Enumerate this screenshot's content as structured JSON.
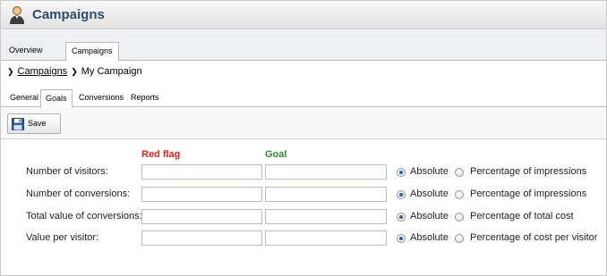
{
  "app": {
    "title": "Campaigns",
    "title_icon": "user-icon"
  },
  "top_tabs": [
    {
      "label": "Overview",
      "active": false
    },
    {
      "label": "Campaigns",
      "active": true
    }
  ],
  "breadcrumb": {
    "root_link": "Campaigns",
    "current": "My Campaign"
  },
  "sub_tabs": [
    {
      "label": "General",
      "active": false
    },
    {
      "label": "Goals",
      "active": true
    },
    {
      "label": "Conversions",
      "active": false
    },
    {
      "label": "Reports",
      "active": false
    }
  ],
  "toolbar": {
    "save_label": "Save",
    "save_icon": "floppy-disk-icon"
  },
  "form": {
    "red_flag_header": "Red flag",
    "goal_header": "Goal",
    "red_flag_color": "#e02020",
    "goal_color": "#2f8f2f",
    "rows": [
      {
        "label": "Number of visitors:",
        "red_flag_value": "",
        "goal_value": "",
        "option_absolute": "Absolute",
        "option_percentage": "Percentage of impressions",
        "selected": "Absolute"
      },
      {
        "label": "Number of conversions:",
        "red_flag_value": "",
        "goal_value": "",
        "option_absolute": "Absolute",
        "option_percentage": "Percentage of impressions",
        "selected": "Absolute"
      },
      {
        "label": "Total value of conversions:",
        "red_flag_value": "",
        "goal_value": "",
        "option_absolute": "Absolute",
        "option_percentage": "Percentage of total cost",
        "selected": "Absolute"
      },
      {
        "label": "Value per visitor:",
        "red_flag_value": "",
        "goal_value": "",
        "option_absolute": "Absolute",
        "option_percentage": "Percentage of cost per visitor",
        "selected": "Absolute"
      }
    ]
  }
}
